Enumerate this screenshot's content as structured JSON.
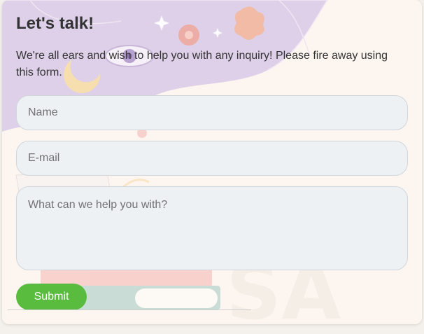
{
  "form": {
    "title": "Let's talk!",
    "intro": "We're all ears and wish to help you with any inquiry! Please fire away using this form.",
    "name_placeholder": "Name",
    "email_placeholder": "E-mail",
    "message_placeholder": "What can we help you with?",
    "submit_label": "Submit"
  },
  "colors": {
    "card_bg": "#fdf6f0",
    "field_bg": "#edf1f4",
    "submit_bg": "#5abc3f",
    "illustration_purple": "#ddd0e8"
  }
}
